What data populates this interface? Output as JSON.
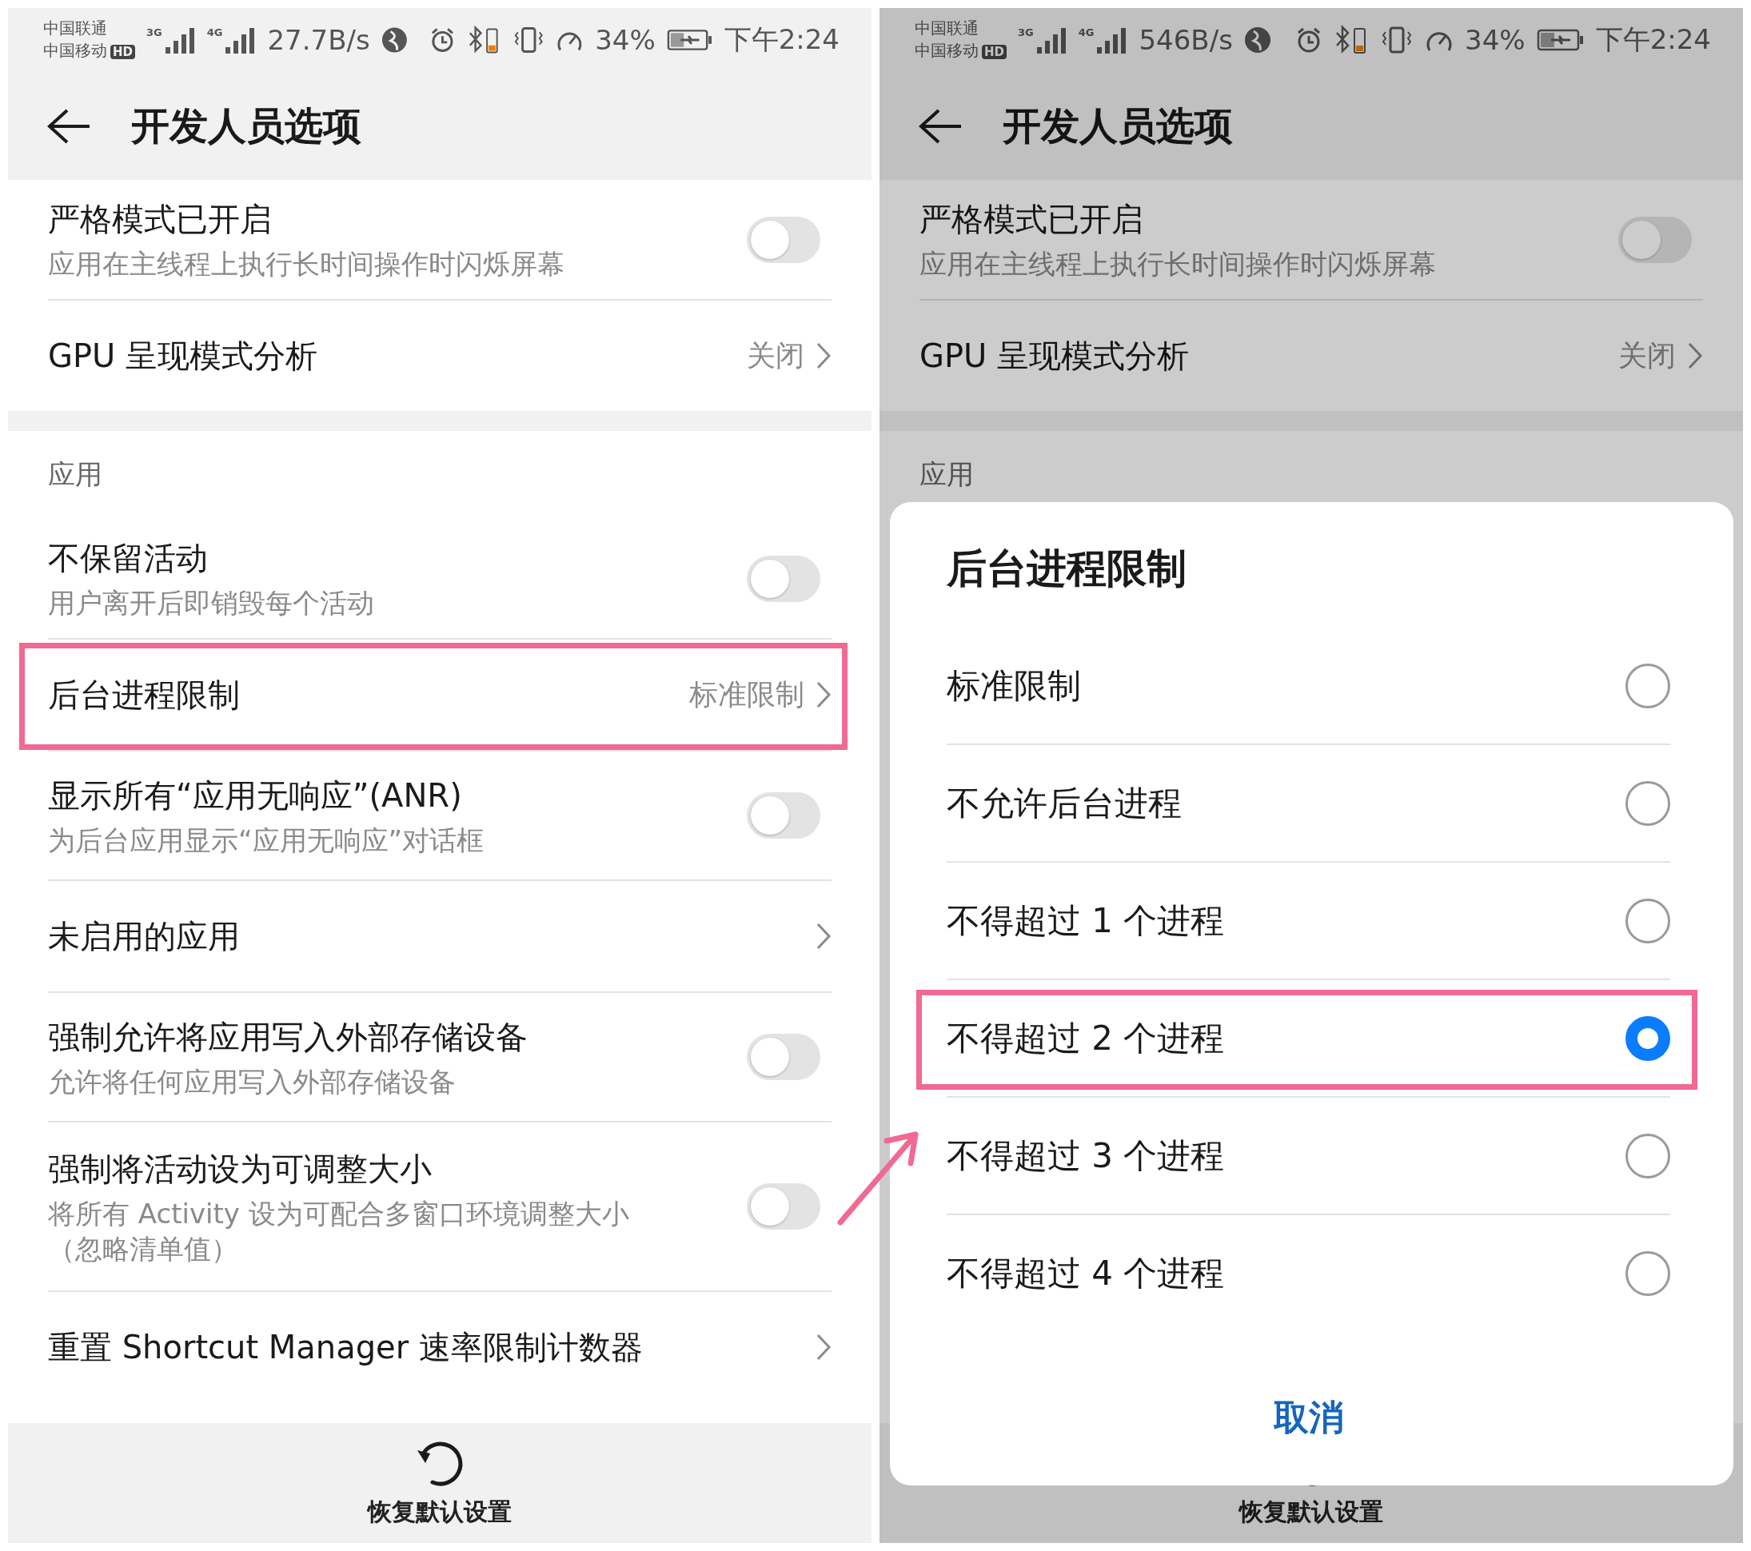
{
  "panels": [
    {
      "status_bar": {
        "carriers": [
          "中国联通",
          "中国移动"
        ],
        "hd_badge": "HD",
        "networks": [
          "3G",
          "4G"
        ],
        "speed": "27.7B/s",
        "battery": "34%",
        "time": "下午2:24"
      },
      "header": {
        "title": "开发人员选项"
      },
      "sections": [
        {
          "items": [
            {
              "kind": "toggle",
              "title": "严格模式已开启",
              "subtitle": "应用在主线程上执行长时间操作时闪烁屏幕",
              "on": false,
              "highlighted": false
            },
            {
              "kind": "link",
              "title": "GPU 呈现模式分析",
              "value": "关闭",
              "highlighted": false
            }
          ]
        },
        {
          "header": "应用",
          "items": [
            {
              "kind": "toggle",
              "title": "不保留活动",
              "subtitle": "用户离开后即销毁每个活动",
              "on": false,
              "highlighted": false
            },
            {
              "kind": "link",
              "title": "后台进程限制",
              "value": "标准限制",
              "highlighted": true
            },
            {
              "kind": "toggle",
              "title": "显示所有“应用无响应”(ANR)",
              "subtitle": "为后台应用显示“应用无响应”对话框",
              "on": false,
              "highlighted": false
            },
            {
              "kind": "link",
              "title": "未启用的应用",
              "highlighted": false
            },
            {
              "kind": "toggle",
              "title": "强制允许将应用写入外部存储设备",
              "subtitle": "允许将任何应用写入外部存储设备",
              "on": false,
              "highlighted": false
            },
            {
              "kind": "toggle",
              "title": "强制将活动设为可调整大小",
              "subtitle": "将所有 Activity 设为可配合多窗口环境调整大小（忽略清单值）",
              "on": false,
              "highlighted": false
            },
            {
              "kind": "link",
              "title": "重置 Shortcut Manager 速率限制计数器",
              "highlighted": false
            }
          ]
        }
      ],
      "footer": {
        "label": "恢复默认设置"
      }
    },
    {
      "status_bar": {
        "carriers": [
          "中国联通",
          "中国移动"
        ],
        "hd_badge": "HD",
        "networks": [
          "3G",
          "4G"
        ],
        "speed": "546B/s",
        "battery": "34%",
        "time": "下午2:24"
      },
      "header": {
        "title": "开发人员选项"
      },
      "sections": [
        {
          "items": [
            {
              "kind": "toggle",
              "title": "严格模式已开启",
              "subtitle": "应用在主线程上执行长时间操作时闪烁屏幕",
              "on": false,
              "highlighted": false
            },
            {
              "kind": "link",
              "title": "GPU 呈现模式分析",
              "value": "关闭",
              "highlighted": false
            }
          ]
        },
        {
          "header": "应用"
        }
      ],
      "footer": {
        "label": "恢复默认设置"
      },
      "dialog": {
        "title": "后台进程限制",
        "options": [
          {
            "label": "标准限制",
            "selected": false,
            "highlighted": false
          },
          {
            "label": "不允许后台进程",
            "selected": false,
            "highlighted": false
          },
          {
            "label": "不得超过 1 个进程",
            "selected": false,
            "highlighted": false
          },
          {
            "label": "不得超过 2 个进程",
            "selected": true,
            "highlighted": true
          },
          {
            "label": "不得超过 3 个进程",
            "selected": false,
            "highlighted": false
          },
          {
            "label": "不得超过 4 个进程",
            "selected": false,
            "highlighted": false
          }
        ],
        "cancel": "取消"
      }
    }
  ]
}
